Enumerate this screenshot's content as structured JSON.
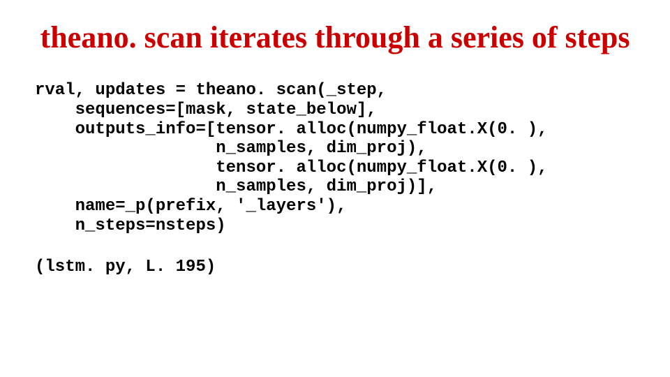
{
  "title": "theano. scan iterates through a series of steps",
  "code": "rval, updates = theano. scan(_step,\n    sequences=[mask, state_below],\n    outputs_info=[tensor. alloc(numpy_float.X(0. ),\n                  n_samples, dim_proj),\n                  tensor. alloc(numpy_float.X(0. ),\n                  n_samples, dim_proj)],\n    name=_p(prefix, '_layers'),\n    n_steps=nsteps)",
  "reference": "(lstm. py, L. 195)"
}
